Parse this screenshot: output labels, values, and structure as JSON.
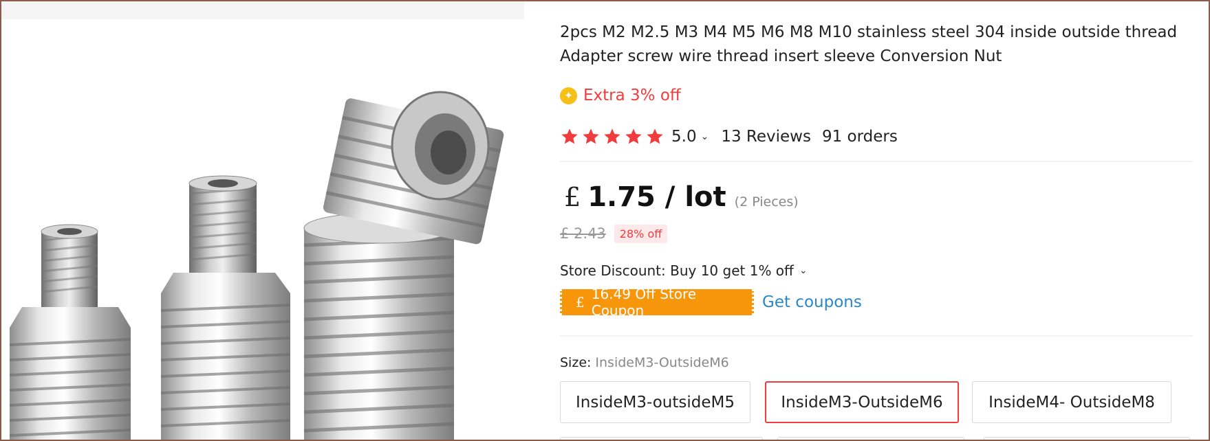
{
  "product": {
    "title_line1": "2pcs M2 M2.5 M3 M4 M5 M6 M8 M10 stainless steel 304 inside outside thread",
    "title_line2": "Adapter screw wire thread insert sleeve Conversion Nut",
    "extra_icon": "coin-icon",
    "extra_discount": "Extra 3% off",
    "rating": {
      "stars": 5,
      "score": "5.0",
      "reviews": "13 Reviews",
      "orders": "91 orders"
    },
    "price": {
      "currency": "£",
      "amount": "1.75 / lot",
      "pieces": "(2 Pieces)",
      "original": "£ 2.43",
      "discount_badge": "28% off"
    },
    "store_discount": "Store Discount: Buy 10 get 1% off",
    "coupon": {
      "currency": "£",
      "text": "16.49 Off Store Coupon",
      "link": "Get coupons"
    },
    "size": {
      "label": "Size:",
      "selected_value": "InsideM3-OutsideM6",
      "options": [
        "InsideM3-outsideM5",
        "InsideM3-OutsideM6",
        "InsideM4- OutsideM8"
      ],
      "selected_index": 1
    }
  },
  "colors": {
    "accent_red": "#f03c3c",
    "star_red": "#f03c3c",
    "coupon_orange": "#f7950b",
    "link_blue": "#2a87c8",
    "coin_yellow": "#f6c018"
  },
  "icons": {
    "star": "star-icon",
    "chevron": "chevron-down-icon"
  }
}
